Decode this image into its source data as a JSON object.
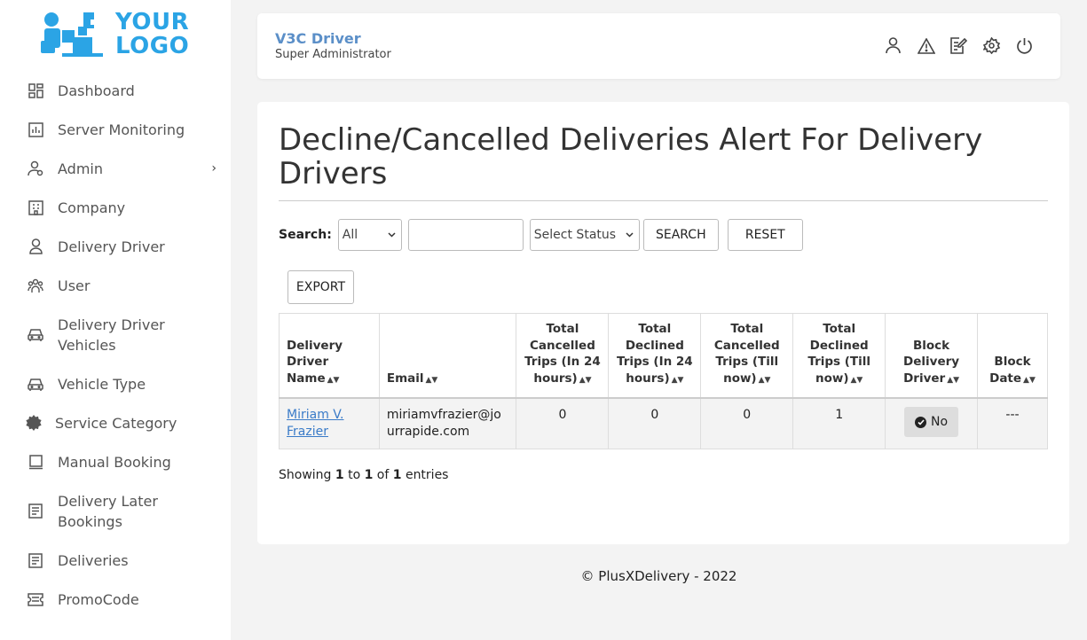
{
  "logo": {
    "line1": "YOUR",
    "line2": "LOGO",
    "color": "#2ba4e5"
  },
  "sidebar": {
    "items": [
      {
        "label": "Dashboard",
        "icon": "dashboard-icon"
      },
      {
        "label": "Server Monitoring",
        "icon": "chart-icon"
      },
      {
        "label": "Admin",
        "icon": "admin-icon",
        "has_submenu": true
      },
      {
        "label": "Company",
        "icon": "building-icon"
      },
      {
        "label": "Delivery Driver",
        "icon": "driver-icon"
      },
      {
        "label": "User",
        "icon": "users-icon"
      },
      {
        "label": "Delivery Driver Vehicles",
        "icon": "car-icon"
      },
      {
        "label": "Vehicle Type",
        "icon": "car-icon"
      },
      {
        "label": "Service Category",
        "icon": "gear-badge-icon"
      },
      {
        "label": "Manual Booking",
        "icon": "booking-icon"
      },
      {
        "label": "Delivery Later Bookings",
        "icon": "list-icon"
      },
      {
        "label": "Deliveries",
        "icon": "list-icon"
      },
      {
        "label": "PromoCode",
        "icon": "ticket-icon"
      }
    ]
  },
  "header": {
    "title": "V3C Driver",
    "subtitle": "Super Administrator",
    "icons": [
      "user-icon",
      "warning-icon",
      "edit-icon",
      "settings-icon",
      "power-icon"
    ]
  },
  "page": {
    "title": "Decline/Cancelled Deliveries Alert For Delivery Drivers"
  },
  "search": {
    "label": "Search:",
    "field_select": "All",
    "text_value": "",
    "status_select": "Select Status",
    "search_button": "SEARCH",
    "reset_button": "RESET"
  },
  "export_button": "EXPORT",
  "table": {
    "headers": [
      "Delivery Driver Name",
      "Email",
      "Total Cancelled Trips (In 24 hours)",
      "Total Declined Trips (In 24 hours)",
      "Total Cancelled Trips (Till now)",
      "Total Declined Trips (Till now)",
      "Block Delivery Driver",
      "Block Date"
    ],
    "rows": [
      {
        "name": "Miriam V. Frazier",
        "email": "miriamvfrazier@jourrapide.com",
        "cancelled_24h": "0",
        "declined_24h": "0",
        "cancelled_total": "0",
        "declined_total": "1",
        "block": "No",
        "block_date": "---"
      }
    ]
  },
  "pagination": {
    "prefix": "Showing ",
    "from": "1",
    "to_word": " to ",
    "to": "1",
    "of_word": " of ",
    "total": "1",
    "suffix": " entries"
  },
  "footer": "© PlusXDelivery - 2022"
}
